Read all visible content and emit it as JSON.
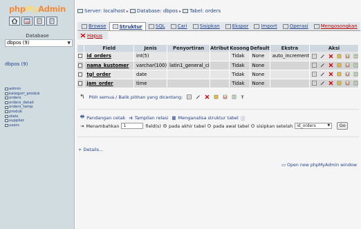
{
  "nav": {
    "logo": {
      "part1": "php",
      "part2": "My",
      "part3": "Admin"
    },
    "icons": [
      "home-icon",
      "query-window-icon",
      "docs-icon",
      "sql-docs-icon"
    ],
    "database_label": "Database",
    "database_select": "dbpos (9)",
    "database_link": "dbpos (9)",
    "tables": [
      "admin",
      "kategori_produk",
      "orders",
      "orders_detail",
      "orders_temp",
      "produk",
      "stats",
      "supplier",
      "users"
    ]
  },
  "breadcrumb": {
    "server": "Server: localhost",
    "database": "Database: dbpos",
    "table": "Tabel: orders"
  },
  "tabs": [
    {
      "label": "Browse",
      "icon": "browse-icon"
    },
    {
      "label": "Struktur",
      "icon": "structure-icon"
    },
    {
      "label": "SQL",
      "icon": "sql-icon"
    },
    {
      "label": "Cari",
      "icon": "search-icon"
    },
    {
      "label": "Sisipkan",
      "icon": "insert-icon"
    },
    {
      "label": "Ekspor",
      "icon": "export-icon"
    },
    {
      "label": "Import",
      "icon": "import-icon"
    },
    {
      "label": "Operasi",
      "icon": "operations-icon"
    },
    {
      "label": "Mengosongkan",
      "icon": "empty-icon"
    }
  ],
  "tab_delete": "Hapus",
  "table": {
    "headers": [
      "Field",
      "Jenis",
      "Penyortiran",
      "Atribut",
      "Kosong",
      "Default",
      "Ekstra",
      "Aksi"
    ],
    "rows": [
      {
        "field": "id_orders",
        "type": "int(5)",
        "collation": "",
        "attr": "",
        "null": "Tidak",
        "default": "None",
        "extra": "auto_increment"
      },
      {
        "field": "nama_kustomer",
        "type": "varchar(100)",
        "collation": "latin1_general_ci",
        "attr": "",
        "null": "Tidak",
        "default": "None",
        "extra": ""
      },
      {
        "field": "tgl_order",
        "type": "date",
        "collation": "",
        "attr": "",
        "null": "Tidak",
        "default": "None",
        "extra": ""
      },
      {
        "field": "jam_order",
        "type": "time",
        "collation": "",
        "attr": "",
        "null": "Tidak",
        "default": "None",
        "extra": ""
      }
    ]
  },
  "checkall": {
    "label": "Pilih semua / Balik pilihan yang dicentang:"
  },
  "tools": {
    "print": "Pandangan cetak",
    "relation": "Tampilan relasi",
    "analyze": "Menganalisa struktur tabel"
  },
  "add_field": {
    "label": "Menambahkan",
    "count": "1",
    "fields_label": "field(s)",
    "opt_end": "pada akhir tabel",
    "opt_begin": "pada awal tabel",
    "opt_after": "sisipkan setelah",
    "after_select": "id_orders",
    "go": "Go"
  },
  "details_link": "+ Details...",
  "new_window_link": "Open new phpMyAdmin window",
  "colors": {
    "nav_bg": "#d0dce0",
    "link": "#23418a",
    "row_odd": "#e6e6e6",
    "row_even": "#d5d5d5",
    "header": "#cfd8e0",
    "delete_red": "#c00000"
  }
}
